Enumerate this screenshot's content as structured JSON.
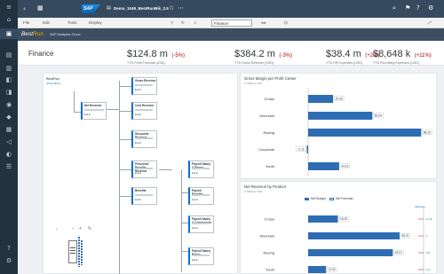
{
  "shell": {
    "tab_label": "Demo_1049_BestRunBik_2.5",
    "logo_text": "SAP"
  },
  "toolbar": {
    "file_label": "File",
    "edit_label": "Edit",
    "tools_label": "Tools",
    "display_label": "Display",
    "section_label": "Finance"
  },
  "appbar": {
    "brand_a": "Best",
    "brand_b": "Run",
    "subtitle": "SAP Analytics Cloud"
  },
  "page": {
    "title": "Finance"
  },
  "kpis": [
    {
      "value": "$124.8 m",
      "pct": "(-5%)",
      "label": "YTD Profit Forecast (USD)"
    },
    {
      "value": "$384.2 m",
      "pct": "(-3%)",
      "label": "YTD Gross Revenue (USD)"
    },
    {
      "value": "$38.4 m",
      "pct": "(+2%)",
      "label": "YTD HR Expenses (USD)"
    },
    {
      "value": "$8,648 k",
      "pct": "(+11%)",
      "label": "YTD Recruiting Expenses (USD)"
    }
  ],
  "tree": {
    "title": "BestRun",
    "filter": "All Products",
    "nodes": [
      {
        "label": "Net Revenue"
      },
      {
        "label": "Gross Revenue"
      },
      {
        "label": "Cost Revenue"
      },
      {
        "label": "Discounts Revenue"
      },
      {
        "label": "Personnel Benefits Revenue"
      },
      {
        "label": "Payroll Salary & Wages"
      },
      {
        "label": "Benefits"
      },
      {
        "label": "Payroll Benefits"
      },
      {
        "label": "Payroll Salary & Commission"
      },
      {
        "label": "Payroll Salary Bonus"
      }
    ]
  },
  "chart_margin": {
    "title": "Gross Margin per Profit Center",
    "subtitle": "in Millions USD",
    "chart_data": {
      "type": "bar",
      "orientation": "horizontal",
      "categories": [
        "Cruise",
        "Mountain",
        "Racing",
        "Corporate",
        "Youth"
      ],
      "values": [
        19.43,
        50.04,
        88.15,
        -0.11,
        24.15
      ]
    }
  },
  "chart_revenue": {
    "title": "Net Revenue by Product",
    "subtitle": "in Millions USD",
    "legend": [
      "Net Budget",
      "Net Forecast"
    ],
    "variance_label": "Variance",
    "chart_data": {
      "type": "bar",
      "orientation": "horizontal",
      "categories": [
        "Cruise",
        "Mountain",
        "Racing",
        "Youth"
      ],
      "series": [
        {
          "name": "Net Budget",
          "values": [
            18.25,
            56.21,
            52.01,
            11.0
          ]
        }
      ],
      "variance": [
        "+2.12",
        "-1",
        "-0.8",
        "+1.2"
      ]
    }
  },
  "zoom": {
    "plus": "+",
    "minus": "−"
  },
  "colors": {
    "shell": "#354a5f",
    "sidebar": "#22323f",
    "bar": "#2e6db4",
    "negative": "#bb0000"
  }
}
